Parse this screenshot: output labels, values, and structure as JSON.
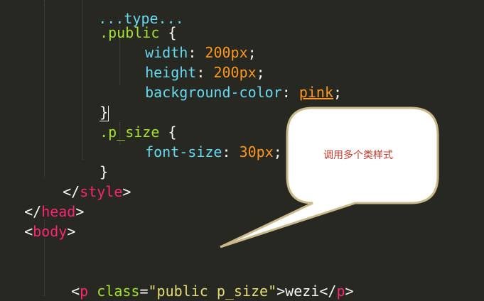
{
  "code": {
    "line0": {
      "text": "    ...type...  "
    },
    "line1": {
      "dot": ".",
      "selector": "public",
      "brace": "{"
    },
    "line2": {
      "prop": "width",
      "colon": ": ",
      "num": "200",
      "unit": "px",
      "semi": ";"
    },
    "line3": {
      "prop": "height",
      "colon": ": ",
      "num": "200",
      "unit": "px",
      "semi": ";"
    },
    "line4": {
      "prop": "background-color",
      "colon": ": ",
      "kw": "pink",
      "semi": ";"
    },
    "line5": {
      "brace": "}"
    },
    "line6": {
      "dot": ".",
      "selector": "p_size",
      "brace": "{"
    },
    "line7": {
      "prop": "font-size",
      "colon": ": ",
      "num": "30",
      "unit": "px",
      "semi": ";"
    },
    "line8": {
      "brace": "}"
    },
    "line9": {
      "open": "</",
      "tag": "style",
      "close": ">"
    },
    "line10": {
      "open": "</",
      "tag": "head",
      "close": ">"
    },
    "line11": {
      "open": "<",
      "tag": "body",
      "close": ">"
    },
    "line12": {
      "open": "<",
      "tag": "p",
      "space": " ",
      "attr": "class",
      "eq": "=",
      "str": "\"public p_size\"",
      "gt": ">",
      "content": "wezi",
      "close_open": "</",
      "close_tag": "p",
      "close_gt": ">"
    }
  },
  "callout": {
    "text": "调用多个类样式"
  },
  "colors": {
    "background": "#272822",
    "callout_fill": "#ffffff",
    "callout_border": "#c9b98a",
    "callout_text": "#c0392b"
  }
}
